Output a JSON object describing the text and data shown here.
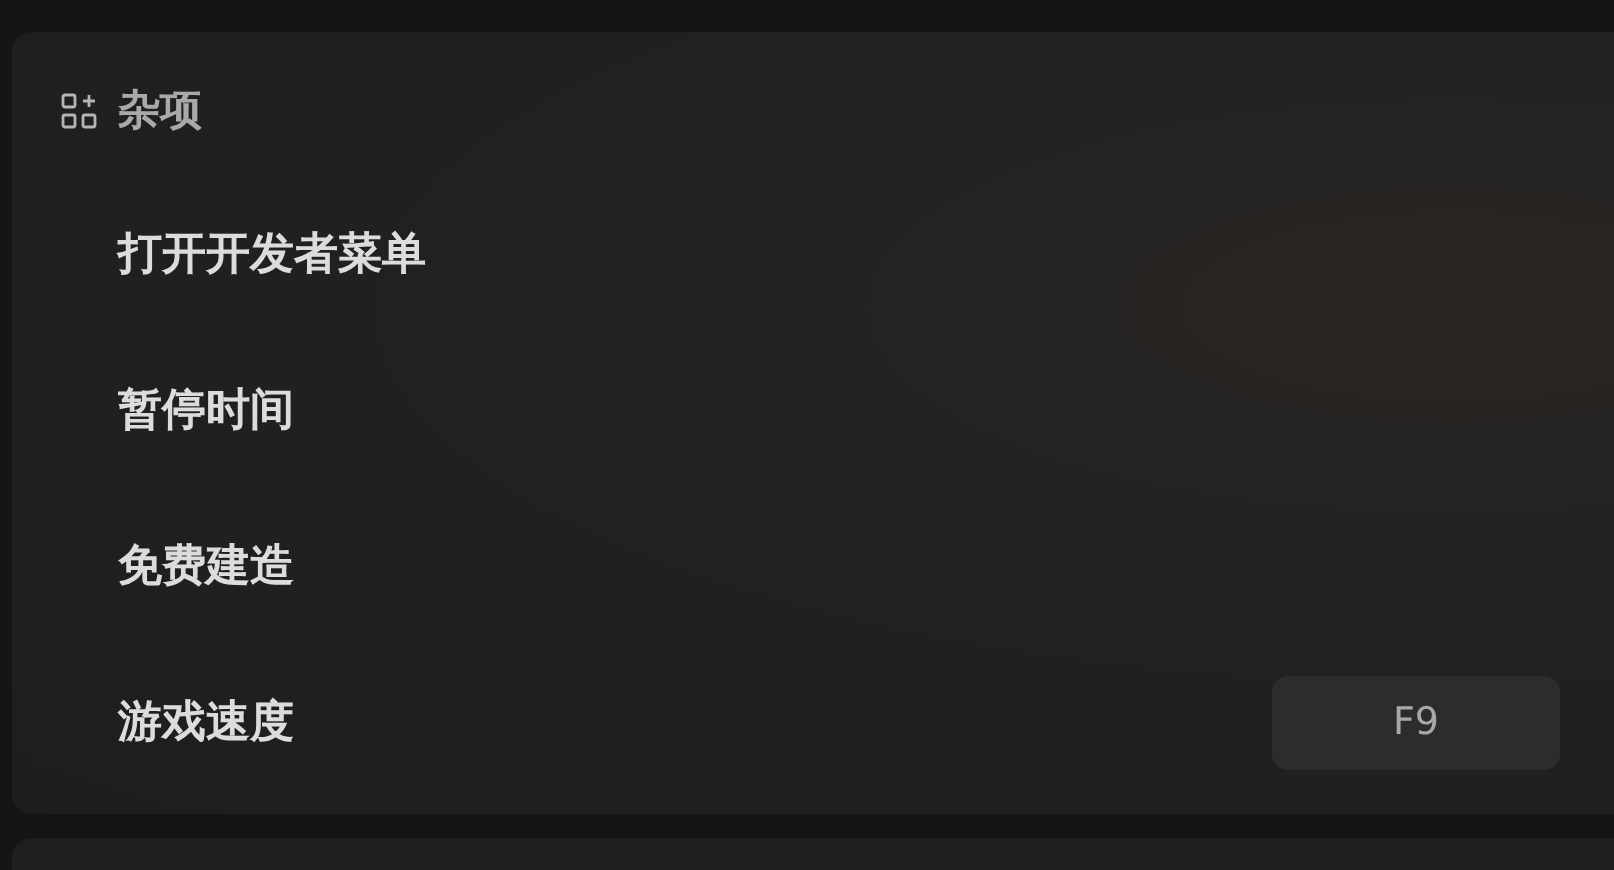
{
  "section": {
    "title": "杂项"
  },
  "options": [
    {
      "label": "打开开发者菜单"
    },
    {
      "label": "暂停时间"
    },
    {
      "label": "免费建造"
    },
    {
      "label": "游戏速度",
      "key": "F9"
    }
  ]
}
